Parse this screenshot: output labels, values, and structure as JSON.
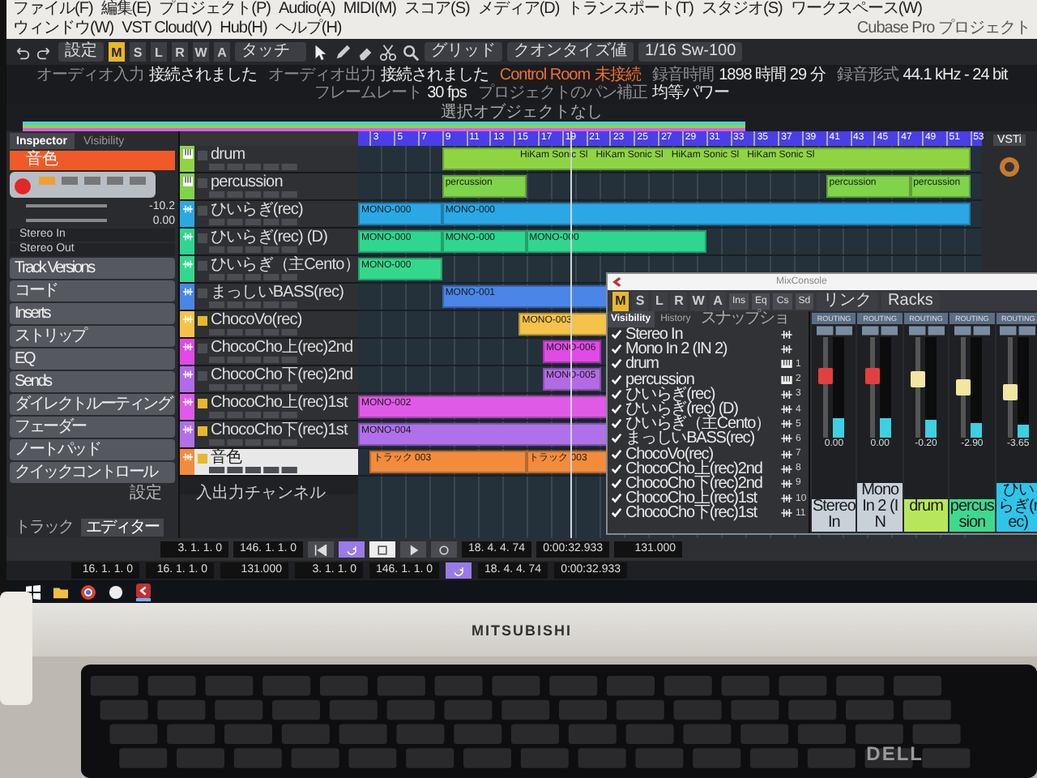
{
  "menu_bar": {
    "items": [
      "ファイル(F)",
      "編集(E)",
      "プロジェクト(P)",
      "Audio(A)",
      "MIDI(M)",
      "スコア(S)",
      "メディア(D)",
      "トランスポート(T)",
      "スタジオ(S)",
      "ワークスペース(W)",
      "ウィンドウ(W)",
      "VST Cloud(V)",
      "Hub(H)",
      "ヘルプ(H)"
    ],
    "title": "Cubase Pro プロジェクト"
  },
  "toolbar": {
    "preset": "設定",
    "modes": [
      {
        "label": "M",
        "selected": true
      },
      {
        "label": "S",
        "selected": false
      },
      {
        "label": "L",
        "selected": false
      },
      {
        "label": "R",
        "selected": false
      },
      {
        "label": "W",
        "selected": false
      },
      {
        "label": "A",
        "selected": false
      }
    ],
    "automation": "タッチ",
    "snap": "グリッド",
    "quantize_type": "クオンタイズ値",
    "quantize": "1/16 Sw-100"
  },
  "status_line": [
    {
      "label": "オーディオ入力",
      "value": "接続されました",
      "alert": false
    },
    {
      "label": "オーディオ出力",
      "value": "接続されました",
      "alert": false
    },
    {
      "label": "Control Room",
      "value": "未接続",
      "alert": true
    },
    {
      "label": "録音時間",
      "value": "1898 時間 29 分",
      "alert": false
    },
    {
      "label": "録音形式",
      "value": "44.1 kHz - 24 bit",
      "alert": false
    },
    {
      "label": "フレームレート",
      "value": "30 fps",
      "alert": false
    },
    {
      "label": "プロジェクトのパン補正",
      "value": "均等パワー",
      "alert": false
    }
  ],
  "info_line": "選択オブジェクトなし",
  "inspector": {
    "tabs": [
      {
        "label": "Inspector",
        "selected": true
      },
      {
        "label": "Visibility",
        "selected": false
      }
    ],
    "track_name": "音色",
    "volume": "-10.2",
    "delay": "0.00",
    "routing": [
      "Stereo In",
      "Stereo Out"
    ],
    "sections": [
      "Track Versions",
      "コード",
      "Inserts",
      "ストリップ",
      "EQ",
      "Sends",
      "ダイレクトルーティング",
      "フェーダー",
      "ノートパッド",
      "クイックコントロール"
    ],
    "settings": "設定",
    "bottom_tabs": [
      {
        "label": "トラック",
        "selected": false
      },
      {
        "label": "エディター",
        "selected": true
      }
    ]
  },
  "ruler": [
    "3",
    "5",
    "7",
    "9",
    "11",
    "13",
    "15",
    "17",
    "19",
    "21",
    "23",
    "25",
    "27",
    "29",
    "31",
    "33",
    "35",
    "37",
    "39",
    "41",
    "43",
    "45",
    "47",
    "49",
    "51",
    "53"
  ],
  "tracks": [
    {
      "name": "drum",
      "color": "#8ed443",
      "kind": "instrument",
      "monitor": false,
      "selected": false,
      "clips": [
        {
          "labels": [
            "HiKam Sonic Sl",
            "HiKam Sonic Sl",
            "HiKam Sonic Sl",
            "HiKam Sonic Sl"
          ]
        }
      ]
    },
    {
      "name": "percussion",
      "color": "#7fd44a",
      "kind": "instrument",
      "monitor": false,
      "selected": false,
      "clips": [
        {
          "labels": [
            "percussion"
          ]
        },
        {
          "labels": [
            "percussion"
          ]
        },
        {
          "labels": [
            "percussion"
          ]
        }
      ]
    },
    {
      "name": "ひいらぎ(rec)",
      "color": "#2aa8e6",
      "kind": "audio",
      "monitor": false,
      "selected": false,
      "clips": [
        {
          "labels": [
            "MONO-000"
          ]
        },
        {
          "labels": [
            "MONO-000"
          ]
        }
      ]
    },
    {
      "name": "ひいらぎ(rec) (D)",
      "color": "#2fd68f",
      "kind": "audio",
      "monitor": false,
      "selected": false,
      "clips": [
        {
          "labels": [
            "MONO-000"
          ]
        },
        {
          "labels": [
            "MONO-000"
          ]
        },
        {
          "labels": [
            "MONO-000"
          ]
        }
      ]
    },
    {
      "name": "ひいらぎ（主Cento）",
      "color": "#34d88c",
      "kind": "audio",
      "monitor": false,
      "selected": false,
      "clips": [
        {
          "labels": [
            "MONO-000"
          ]
        }
      ]
    },
    {
      "name": "まっしいBASS(rec)",
      "color": "#4a86e8",
      "kind": "audio",
      "monitor": false,
      "selected": false,
      "clips": [
        {
          "labels": [
            "MONO-001"
          ]
        }
      ]
    },
    {
      "name": "ChocoVo(rec)",
      "color": "#f5c24a",
      "kind": "audio",
      "monitor": true,
      "selected": false,
      "clips": [
        {
          "labels": [
            "MONO-003"
          ]
        }
      ]
    },
    {
      "name": "ChocoCho上(rec)2nd",
      "color": "#e04ae6",
      "kind": "audio",
      "monitor": false,
      "selected": false,
      "clips": [
        {
          "labels": [
            "MONO-006"
          ]
        }
      ]
    },
    {
      "name": "ChocoCho下(rec)2nd",
      "color": "#b46ae6",
      "kind": "audio",
      "monitor": false,
      "selected": false,
      "clips": [
        {
          "labels": [
            "MONO-005"
          ]
        }
      ]
    },
    {
      "name": "ChocoCho上(rec)1st",
      "color": "#e05ae8",
      "kind": "audio",
      "monitor": true,
      "selected": false,
      "clips": [
        {
          "labels": [
            "MONO-002"
          ]
        }
      ]
    },
    {
      "name": "ChocoCho下(rec)1st",
      "color": "#b070ea",
      "kind": "audio",
      "monitor": true,
      "selected": false,
      "clips": [
        {
          "labels": [
            "MONO-004"
          ]
        }
      ]
    },
    {
      "name": "音色",
      "color": "#f28c3c",
      "kind": "audio",
      "monitor": true,
      "selected": true,
      "clips": [
        {
          "labels": [
            "トラック 003"
          ]
        },
        {
          "labels": [
            "トラック 003"
          ]
        }
      ]
    }
  ],
  "folder": "入出力チャンネル",
  "vsti": {
    "tab": "VSTi"
  },
  "mixer": {
    "title": "MixConsole",
    "modes": [
      {
        "label": "M",
        "selected": true
      },
      {
        "label": "S",
        "selected": false
      },
      {
        "label": "L",
        "selected": false
      },
      {
        "label": "R",
        "selected": false
      },
      {
        "label": "W",
        "selected": false
      },
      {
        "label": "A",
        "selected": false
      }
    ],
    "racks": [
      "Ins",
      "Eq",
      "Cs",
      "Sd"
    ],
    "link": "リンク",
    "rack_menu": "Racks",
    "tabs": [
      {
        "label": "Visibility",
        "selected": true
      },
      {
        "label": "History",
        "selected": false
      },
      {
        "label": "スナップショ",
        "selected": false
      }
    ],
    "items": [
      {
        "name": "Stereo In",
        "kind": "input",
        "checked": true
      },
      {
        "name": "Mono In 2 (IN 2)",
        "kind": "input",
        "checked": true
      },
      {
        "name": "drum",
        "number": "1",
        "kind": "instrument",
        "checked": true
      },
      {
        "name": "percussion",
        "number": "2",
        "kind": "instrument",
        "checked": true
      },
      {
        "name": "ひいらぎ(rec)",
        "number": "3",
        "kind": "audio",
        "checked": true
      },
      {
        "name": "ひいらぎ(rec) (D)",
        "number": "4",
        "kind": "audio",
        "checked": true
      },
      {
        "name": "ひいらぎ（主Cento）",
        "number": "5",
        "kind": "audio",
        "checked": true
      },
      {
        "name": "まっしいBASS(rec)",
        "number": "6",
        "kind": "audio",
        "checked": true
      },
      {
        "name": "ChocoVo(rec)",
        "number": "7",
        "kind": "audio",
        "checked": true
      },
      {
        "name": "ChocoCho上(rec)2nd",
        "number": "8",
        "kind": "audio",
        "checked": true
      },
      {
        "name": "ChocoCho下(rec)2nd",
        "number": "9",
        "kind": "audio",
        "checked": true
      },
      {
        "name": "ChocoCho上(rec)1st",
        "number": "10",
        "kind": "audio",
        "checked": true
      },
      {
        "name": "ChocoCho下(rec)1st",
        "number": "11",
        "kind": "audio",
        "checked": true
      }
    ],
    "channels": [
      {
        "name": "Stereo In",
        "section": "ROUTING",
        "kind": "input",
        "color": "#c8d0d8",
        "level": 0.62,
        "value": "0.00"
      },
      {
        "name": "Mono In 2 (IN",
        "section": "ROUTING",
        "kind": "input",
        "color": "#c8d0d8",
        "level": 0.62,
        "value": "0.00"
      },
      {
        "name": "drum",
        "section": "ROUTING",
        "kind": "track",
        "color": "#b8e65a",
        "level": 0.58,
        "value": "-0.20"
      },
      {
        "name": "percussion",
        "section": "ROUTING",
        "kind": "track",
        "color": "#3fd98e",
        "level": 0.5,
        "value": "-2.90"
      },
      {
        "name": "ひいらぎ(rec)",
        "section": "ROUTING",
        "kind": "track",
        "color": "#2fc4ea",
        "level": 0.45,
        "value": "-3.65"
      }
    ]
  },
  "transport": {
    "left_locator": "3. 1. 1. 0",
    "right_locator": "146. 1. 1. 0",
    "cycle": true,
    "position_bars": "18. 4. 4. 74",
    "position_time": "0:00:32.933",
    "tempo": "131.000"
  },
  "bottom_bar": {
    "punch_in": "16. 1. 1. 0",
    "punch_out": "16. 1. 1. 0",
    "tempo": "131.000",
    "left_locator": "3. 1. 1. 0",
    "right_locator": "146. 1. 1. 0",
    "cycle": true,
    "position_bars": "18. 4. 4. 74",
    "position_time": "0:00:32.933"
  },
  "monitor": {
    "brand": "MITSUBISHI"
  },
  "keyboard": {
    "brand": "DELL"
  }
}
